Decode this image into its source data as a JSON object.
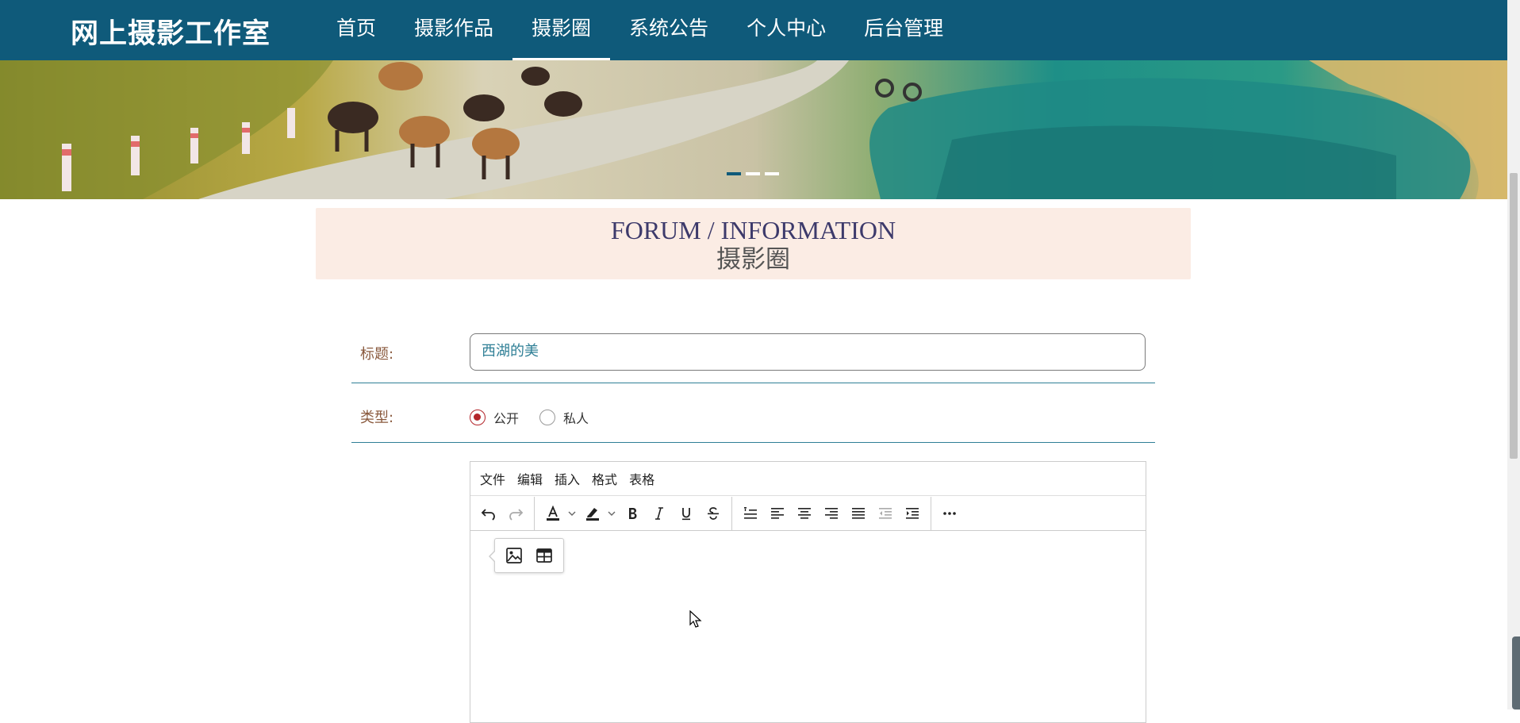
{
  "header": {
    "brand": "网上摄影工作室",
    "nav": [
      {
        "label": "首页",
        "active": false
      },
      {
        "label": "摄影作品",
        "active": false
      },
      {
        "label": "摄影圈",
        "active": true
      },
      {
        "label": "系统公告",
        "active": false
      },
      {
        "label": "个人中心",
        "active": false
      },
      {
        "label": "后台管理",
        "active": false
      }
    ],
    "bg_color": "#0f5a7a"
  },
  "banner": {
    "slides": 3,
    "active_slide": 1
  },
  "section": {
    "title_en": "FORUM / INFORMATION",
    "title_cn": "摄影圈"
  },
  "form": {
    "title_label": "标题:",
    "title_value": "西湖的美",
    "type_label": "类型:",
    "type_options": [
      {
        "label": "公开",
        "checked": true
      },
      {
        "label": "私人",
        "checked": false
      }
    ]
  },
  "editor": {
    "menu": [
      "文件",
      "编辑",
      "插入",
      "格式",
      "表格"
    ],
    "toolbar_icons": [
      "undo-icon",
      "redo-icon",
      "text-color-icon",
      "highlight-icon",
      "bold-icon",
      "italic-icon",
      "underline-icon",
      "strikethrough-icon",
      "line-height-icon",
      "align-left-icon",
      "align-center-icon",
      "align-right-icon",
      "align-justify-icon",
      "outdent-icon",
      "indent-icon",
      "more-icon"
    ],
    "quick_insert": [
      "image-icon",
      "table-icon"
    ]
  },
  "colors": {
    "accent": "#0f5a7a",
    "label": "#8a5a3e",
    "radio_checked": "#b3252a",
    "section_bg": "#fbece4",
    "row_border": "#2f7f96"
  }
}
